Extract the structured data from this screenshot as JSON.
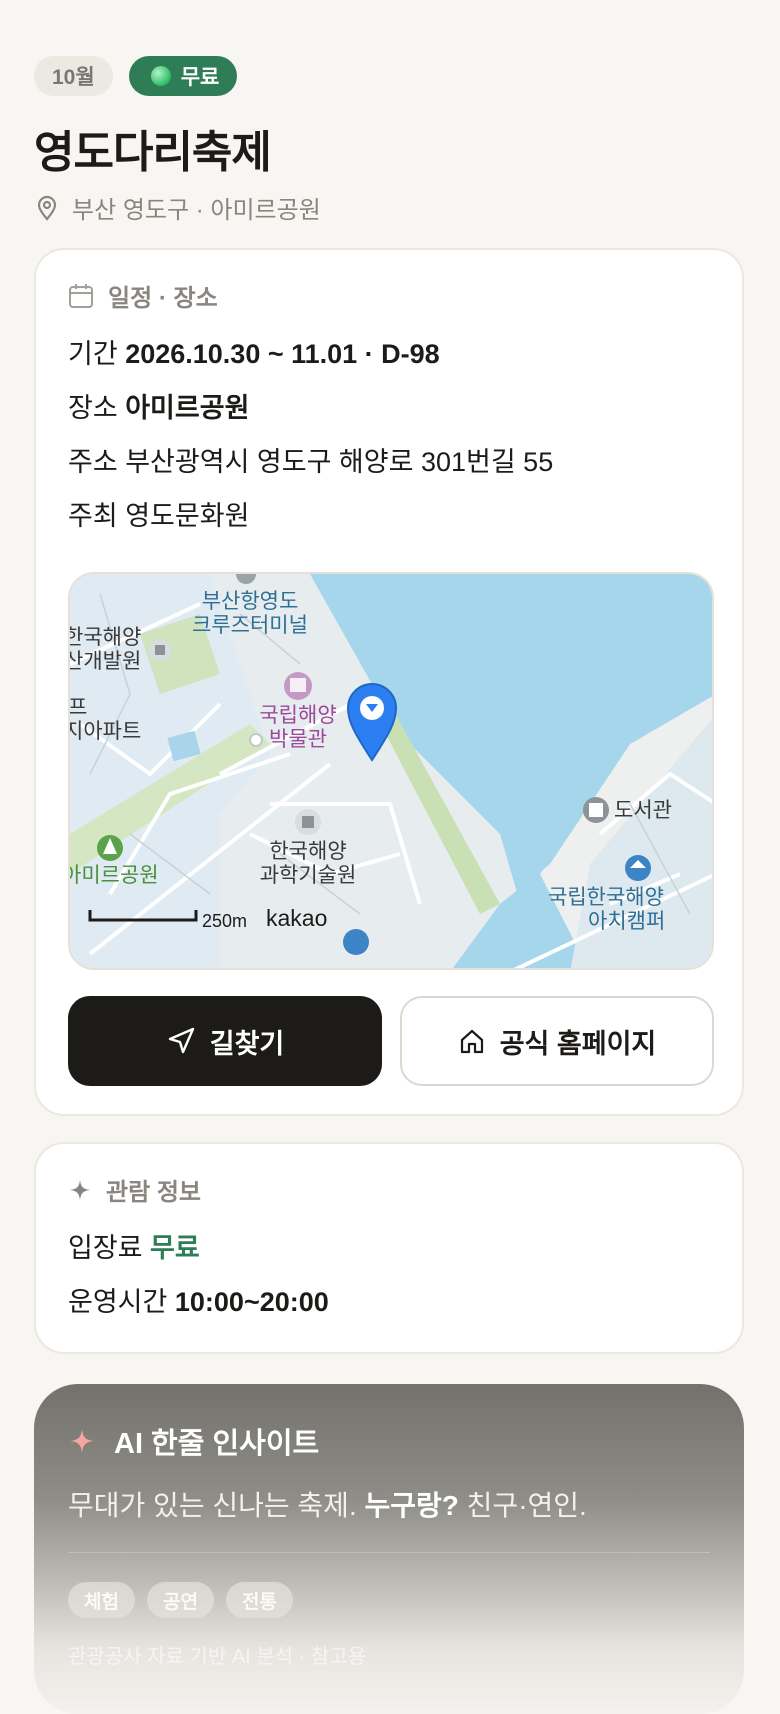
{
  "header": {
    "month_badge": "10월",
    "fee_badge": "무료",
    "title": "영도다리축제",
    "location": "부산 영도구 · 아미르공원"
  },
  "schedule": {
    "section_title": "일정 · 장소",
    "period_label": "기간",
    "period_value": "2026.10.30 ~ 11.01 · D-98",
    "venue_label": "장소",
    "venue_value": "아미르공원",
    "address_label": "주소",
    "address_value": "부산광역시 영도구 해양로 301번길 55",
    "host_label": "주최",
    "host_value": "영도문화원"
  },
  "map": {
    "labels": {
      "terminal_1": "부산항영도",
      "terminal_2": "크루즈터미널",
      "kiost_1": "한국해양",
      "kiost_2": "산개발원",
      "apt_1": "프",
      "apt_2": "지아파트",
      "museum_1": "국립해양",
      "museum_2": "박물관",
      "library": "도서관",
      "park": "아미르공원",
      "science_1": "한국해양",
      "science_2": "과학기술원",
      "campus_1": "국립한국해양",
      "campus_2": "아치캠퍼",
      "scale": "250m",
      "brand": "kakao"
    },
    "colors": {
      "water": "#a6d6ec",
      "land": "#dbe8f1",
      "park": "#c9dfb4",
      "road": "#ffffff",
      "pin": "#2c7ff0"
    }
  },
  "buttons": {
    "directions": "길찾기",
    "homepage": "공식 홈페이지"
  },
  "visit": {
    "section_title": "관람 정보",
    "fee_label": "입장료",
    "fee_value": "무료",
    "hours_label": "운영시간",
    "hours_value": "10:00~20:00"
  },
  "ai": {
    "title": "AI 한줄 인사이트",
    "summary": "무대가 있는 신나는 축제.",
    "who_label": "누구랑?",
    "who_value": "친구·연인.",
    "tags": [
      "체험",
      "공연",
      "전통"
    ],
    "footer": "관광공사 자료 기반 AI 분석 · 참고용"
  },
  "colors": {
    "accent_green": "#2f7d57",
    "dark": "#1d1b18",
    "muted": "#8a857e"
  }
}
